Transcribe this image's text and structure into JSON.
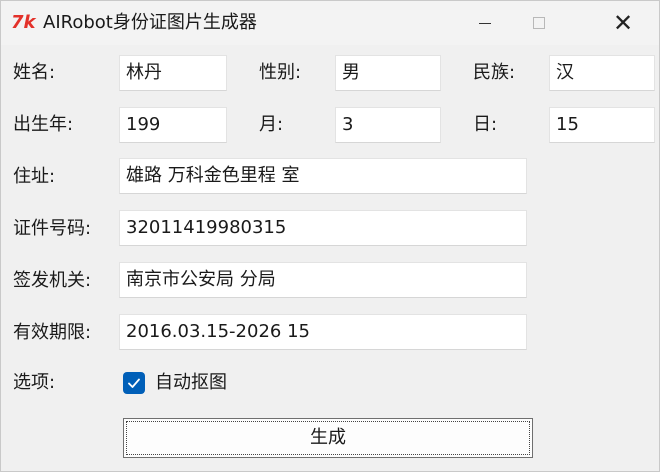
{
  "window": {
    "icon_text": "7k",
    "title": "AIRobot身份证图片生成器",
    "close_glyph": "✕"
  },
  "form": {
    "name_label": "姓名:",
    "name_value": "林丹",
    "gender_label": "性别:",
    "gender_value": "男",
    "ethnicity_label": "民族:",
    "ethnicity_value": "汉",
    "birth_year_label": "出生年:",
    "birth_year_value": "199",
    "birth_month_label": "月:",
    "birth_month_value": "3",
    "birth_day_label": "日:",
    "birth_day_value": "15",
    "address_label": "住址:",
    "address_value": "雄路 万科金色里程 室",
    "id_number_label": "证件号码:",
    "id_number_value": "32011419980315",
    "issuer_label": "签发机关:",
    "issuer_value": "南京市公安局 分局",
    "validity_label": "有效期限:",
    "validity_value": "2016.03.15-2026 15",
    "options_label": "选项:",
    "auto_cutout_label": "自动抠图",
    "auto_cutout_checked": true
  },
  "actions": {
    "generate_label": "生成"
  },
  "colors": {
    "app_icon": "#e3312a",
    "checkbox_accent": "#005fb8",
    "window_bg": "#f0f0f0",
    "field_bg": "#ffffff"
  }
}
